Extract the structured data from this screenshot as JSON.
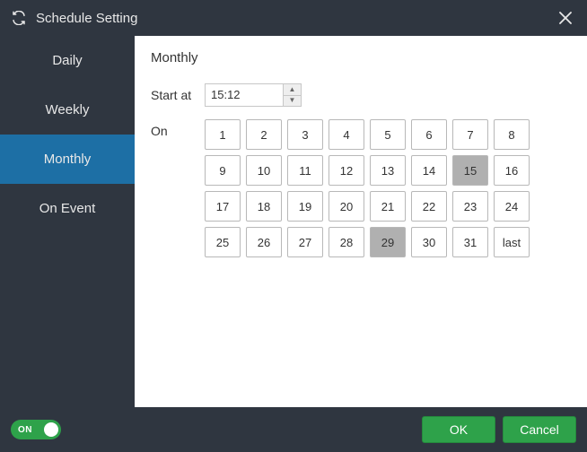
{
  "titlebar": {
    "title": "Schedule Setting"
  },
  "sidebar": {
    "tabs": [
      {
        "label": "Daily",
        "active": false
      },
      {
        "label": "Weekly",
        "active": false
      },
      {
        "label": "Monthly",
        "active": true
      },
      {
        "label": "On Event",
        "active": false
      }
    ]
  },
  "panel": {
    "title": "Monthly",
    "start_at_label": "Start at",
    "start_at_value": "15:12",
    "on_label": "On",
    "days": [
      {
        "label": "1",
        "selected": false
      },
      {
        "label": "2",
        "selected": false
      },
      {
        "label": "3",
        "selected": false
      },
      {
        "label": "4",
        "selected": false
      },
      {
        "label": "5",
        "selected": false
      },
      {
        "label": "6",
        "selected": false
      },
      {
        "label": "7",
        "selected": false
      },
      {
        "label": "8",
        "selected": false
      },
      {
        "label": "9",
        "selected": false
      },
      {
        "label": "10",
        "selected": false
      },
      {
        "label": "11",
        "selected": false
      },
      {
        "label": "12",
        "selected": false
      },
      {
        "label": "13",
        "selected": false
      },
      {
        "label": "14",
        "selected": false
      },
      {
        "label": "15",
        "selected": true
      },
      {
        "label": "16",
        "selected": false
      },
      {
        "label": "17",
        "selected": false
      },
      {
        "label": "18",
        "selected": false
      },
      {
        "label": "19",
        "selected": false
      },
      {
        "label": "20",
        "selected": false
      },
      {
        "label": "21",
        "selected": false
      },
      {
        "label": "22",
        "selected": false
      },
      {
        "label": "23",
        "selected": false
      },
      {
        "label": "24",
        "selected": false
      },
      {
        "label": "25",
        "selected": false
      },
      {
        "label": "26",
        "selected": false
      },
      {
        "label": "27",
        "selected": false
      },
      {
        "label": "28",
        "selected": false
      },
      {
        "label": "29",
        "selected": true
      },
      {
        "label": "30",
        "selected": false
      },
      {
        "label": "31",
        "selected": false
      },
      {
        "label": "last",
        "selected": false
      }
    ]
  },
  "footer": {
    "toggle_on": true,
    "toggle_label": "ON",
    "ok_label": "OK",
    "cancel_label": "Cancel"
  }
}
